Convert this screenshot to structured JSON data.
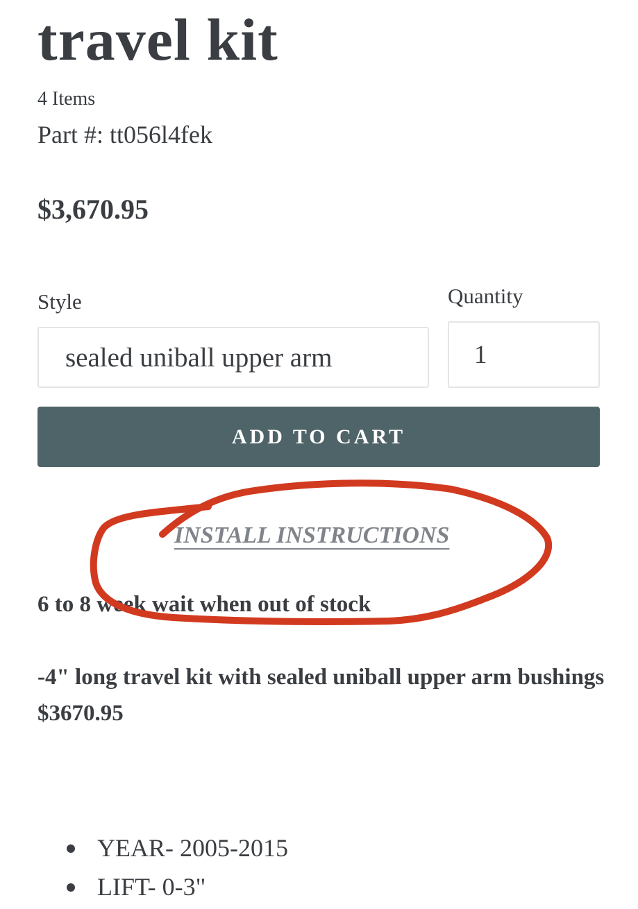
{
  "product": {
    "title_partial": "travel kit",
    "title": "travel kit",
    "items_count": "4 Items",
    "part_number": "Part #: tt056l4fek",
    "price": "$3,670.95"
  },
  "form": {
    "style_label": "Style",
    "style_value": "sealed uniball upper arm",
    "quantity_label": "Quantity",
    "quantity_value": "1",
    "add_to_cart_label": "ADD TO CART"
  },
  "links": {
    "install_instructions": "INSTALL INSTRUCTIONS"
  },
  "description": {
    "wait_notice": "6 to 8 week wait when out of stock",
    "kit_description": "-4\" long travel kit with sealed uniball upper arm bushings $3670.95",
    "specs": [
      "YEAR- 2005-2015",
      "LIFT- 0-3\""
    ]
  },
  "colors": {
    "button": "#4f6468",
    "text": "#3a3d41",
    "link": "#80848a",
    "annotation": "#d23a1f"
  }
}
